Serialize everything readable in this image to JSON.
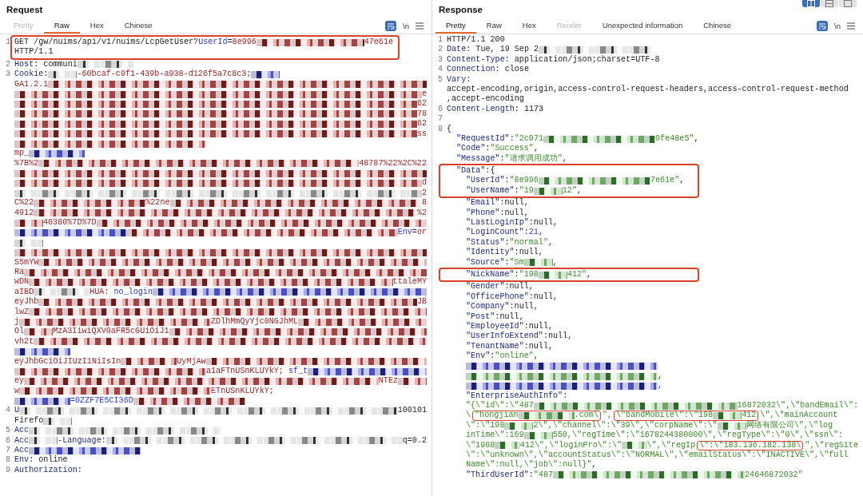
{
  "layout_toggles": [
    {
      "selected": true
    },
    {
      "selected": false
    },
    {
      "selected": false
    }
  ],
  "request": {
    "title": "Request",
    "tabs": [
      {
        "label": "Pretty",
        "selected": false,
        "disabled": true
      },
      {
        "label": "Raw",
        "selected": true,
        "disabled": false
      },
      {
        "label": "Hex",
        "selected": false,
        "disabled": false
      },
      {
        "label": "Chinese",
        "selected": false,
        "disabled": false
      }
    ],
    "toolbar": {
      "wrap_on": true,
      "newline_label": "\\n"
    },
    "lines": [
      {
        "kind": "boxed_rows",
        "rows": [
          {
            "kind": "row",
            "number": "1",
            "segments": [
              {
                "kind": "plain",
                "text": "GET /gw/nuims/api/v1/nuims/LcpGetUser?"
              },
              {
                "kind": "param",
                "text": "UserId"
              },
              {
                "kind": "plain",
                "text": "="
              },
              {
                "kind": "value",
                "text": "8e996"
              },
              {
                "kind": "redacted_red_l"
              },
              {
                "kind": "value",
                "text": "47e61e"
              }
            ]
          },
          {
            "kind": "row",
            "segments": [
              {
                "kind": "plain",
                "text": "HTTP/1.1"
              }
            ]
          }
        ]
      },
      {
        "kind": "row",
        "number": "2",
        "segments": [
          {
            "kind": "header",
            "text": "Host"
          },
          {
            "kind": "plain",
            "text": ": communi"
          },
          {
            "kind": "redacted_grey_m"
          }
        ]
      },
      {
        "kind": "row",
        "number": "3",
        "segments": [
          {
            "kind": "header",
            "text": "Cookie"
          },
          {
            "kind": "plain",
            "text": ":"
          },
          {
            "kind": "redacted_grey_s"
          },
          {
            "kind": "value",
            "text": "-60bcaf-c9f1-439b-a938-d126f5a7c8c3;"
          },
          {
            "kind": "redacted_blue_s"
          }
        ]
      },
      {
        "kind": "row",
        "segments": [
          {
            "kind": "value",
            "text": "GA1.2.1"
          },
          {
            "kind": "redacted_red"
          }
        ]
      },
      {
        "kind": "row",
        "segments": [
          {
            "kind": "redacted_red"
          },
          {
            "kind": "value",
            "text": "e"
          }
        ]
      },
      {
        "kind": "row",
        "segments": [
          {
            "kind": "redacted_red"
          },
          {
            "kind": "value",
            "text": "62"
          }
        ]
      },
      {
        "kind": "row",
        "segments": [
          {
            "kind": "redacted_red"
          },
          {
            "kind": "value",
            "text": "78"
          }
        ]
      },
      {
        "kind": "row",
        "segments": [
          {
            "kind": "redacted_red"
          },
          {
            "kind": "value",
            "text": "62"
          }
        ]
      },
      {
        "kind": "row",
        "segments": [
          {
            "kind": "redacted_red"
          },
          {
            "kind": "value",
            "text": "ss"
          }
        ]
      },
      {
        "kind": "row",
        "segments": [
          {
            "kind": "redacted_red_xl"
          }
        ]
      },
      {
        "kind": "row",
        "segments": [
          {
            "kind": "value",
            "text": "mp_"
          },
          {
            "kind": "redacted_blue_m"
          }
        ]
      },
      {
        "kind": "row",
        "segments": [
          {
            "kind": "value",
            "text": "%7B%2"
          },
          {
            "kind": "redacted_red"
          },
          {
            "kind": "value",
            "text": "48787%22%2C%22"
          }
        ]
      },
      {
        "kind": "row",
        "segments": [
          {
            "kind": "redacted_red"
          }
        ]
      },
      {
        "kind": "row",
        "segments": [
          {
            "kind": "redacted_red"
          },
          {
            "kind": "value",
            "text": "d"
          }
        ]
      },
      {
        "kind": "row",
        "segments": [
          {
            "kind": "redacted_grey"
          },
          {
            "kind": "value",
            "text": "2"
          }
        ]
      },
      {
        "kind": "row",
        "segments": [
          {
            "kind": "value",
            "text": "C%22"
          },
          {
            "kind": "redacted_red_l"
          },
          {
            "kind": "value",
            "text": "%22ne"
          },
          {
            "kind": "redacted_red"
          },
          {
            "kind": "value",
            "text": "8"
          }
        ]
      },
      {
        "kind": "row",
        "segments": [
          {
            "kind": "value",
            "text": "4912"
          },
          {
            "kind": "redacted_red"
          },
          {
            "kind": "value",
            "text": "%2"
          }
        ]
      },
      {
        "kind": "row",
        "segments": [
          {
            "kind": "redacted_red_s"
          },
          {
            "kind": "value",
            "text": "40380%7D%7D"
          },
          {
            "kind": "redacted_red"
          }
        ]
      },
      {
        "kind": "row",
        "segments": [
          {
            "kind": "redacted_blue_l"
          },
          {
            "kind": "redacted_red"
          },
          {
            "kind": "param",
            "text": "Env"
          },
          {
            "kind": "plain",
            "text": "="
          },
          {
            "kind": "value",
            "text": "or"
          }
        ]
      },
      {
        "kind": "row",
        "segments": [
          {
            "kind": "redacted_grey_s"
          }
        ]
      },
      {
        "kind": "row",
        "segments": [
          {
            "kind": "redacted_red"
          }
        ]
      },
      {
        "kind": "row",
        "segments": [
          {
            "kind": "value",
            "text": "S5mYW"
          },
          {
            "kind": "redacted_red"
          }
        ]
      },
      {
        "kind": "row",
        "segments": [
          {
            "kind": "value",
            "text": "Ra"
          },
          {
            "kind": "redacted_red"
          }
        ]
      },
      {
        "kind": "row",
        "segments": [
          {
            "kind": "value",
            "text": "wDN"
          },
          {
            "kind": "redacted_red"
          },
          {
            "kind": "value",
            "text": "ttaleMY"
          }
        ]
      },
      {
        "kind": "row",
        "segments": [
          {
            "kind": "value",
            "text": "aIBD"
          },
          {
            "kind": "redacted_grey_m"
          },
          {
            "kind": "value",
            "text": "HUA: "
          },
          {
            "kind": "param",
            "text": "no_login"
          },
          {
            "kind": "redacted_blue"
          }
        ]
      },
      {
        "kind": "row",
        "segments": [
          {
            "kind": "value",
            "text": "eyJhb"
          },
          {
            "kind": "redacted_red"
          },
          {
            "kind": "value",
            "text": "JB"
          }
        ]
      },
      {
        "kind": "row",
        "segments": [
          {
            "kind": "value",
            "text": "lwZ"
          },
          {
            "kind": "redacted_red"
          }
        ]
      },
      {
        "kind": "row",
        "segments": [
          {
            "kind": "value",
            "text": "j"
          },
          {
            "kind": "redacted_red_xl"
          },
          {
            "kind": "value",
            "text": "ZDlhMmQyYjc0NGJhML"
          },
          {
            "kind": "redacted_red"
          }
        ]
      },
      {
        "kind": "row",
        "segments": [
          {
            "kind": "value",
            "text": "Ol"
          },
          {
            "kind": "redacted_red_s"
          },
          {
            "kind": "value",
            "text": "MzA3IiwiQXV0aFR5cGUiOiJ1"
          },
          {
            "kind": "redacted_red"
          }
        ]
      },
      {
        "kind": "row",
        "segments": [
          {
            "kind": "value",
            "text": "vh2t"
          },
          {
            "kind": "redacted_red"
          }
        ]
      },
      {
        "kind": "row",
        "segments": [
          {
            "kind": "redacted_blue_m"
          }
        ]
      },
      {
        "kind": "row",
        "segments": [
          {
            "kind": "value",
            "text": "eyJhbGciOiJIUzI1NiIsIn"
          },
          {
            "kind": "redacted_red_m"
          },
          {
            "kind": "value",
            "text": "UyMjAw"
          },
          {
            "kind": "redacted_red"
          }
        ]
      },
      {
        "kind": "row",
        "segments": [
          {
            "kind": "redacted_red_xl"
          },
          {
            "kind": "value",
            "text": "a1aFTnUSnKLUYkY; "
          },
          {
            "kind": "param",
            "text": "sf_t"
          },
          {
            "kind": "redacted_blue"
          }
        ]
      },
      {
        "kind": "row",
        "segments": [
          {
            "kind": "value",
            "text": "ey"
          },
          {
            "kind": "redacted_red"
          },
          {
            "kind": "value",
            "text": "NTEz"
          },
          {
            "kind": "redacted_red_s"
          }
        ]
      },
      {
        "kind": "row",
        "segments": [
          {
            "kind": "value",
            "text": "w"
          },
          {
            "kind": "redacted_red_xl"
          },
          {
            "kind": "value",
            "text": "ETnUSnKLUYkY;"
          }
        ]
      },
      {
        "kind": "row",
        "segments": [
          {
            "kind": "redacted_blue_m"
          },
          {
            "kind": "param",
            "text": "=0ZZF7E5CI36D"
          },
          {
            "kind": "redacted_red_l"
          }
        ]
      },
      {
        "kind": "row",
        "number": "4",
        "segments": [
          {
            "kind": "header",
            "text": "U"
          },
          {
            "kind": "redacted_grey"
          },
          {
            "kind": "plain",
            "text": "100101"
          }
        ]
      },
      {
        "kind": "row",
        "segments": [
          {
            "kind": "plain",
            "text": "Firefo"
          },
          {
            "kind": "redacted_grey_s"
          }
        ]
      },
      {
        "kind": "row",
        "number": "5",
        "segments": [
          {
            "kind": "header",
            "text": "Acc"
          },
          {
            "kind": "redacted_grey_xl"
          }
        ]
      },
      {
        "kind": "row",
        "number": "6",
        "segments": [
          {
            "kind": "header",
            "text": "Acc"
          },
          {
            "kind": "redacted_grey_s"
          },
          {
            "kind": "header",
            "text": "-Language"
          },
          {
            "kind": "plain",
            "text": ":"
          },
          {
            "kind": "redacted_grey"
          },
          {
            "kind": "plain",
            "text": "q=0.2"
          }
        ]
      },
      {
        "kind": "row",
        "number": "7",
        "segments": [
          {
            "kind": "header",
            "text": "Acc"
          },
          {
            "kind": "redacted_blue_l"
          }
        ]
      },
      {
        "kind": "row",
        "number": "8",
        "segments": [
          {
            "kind": "header",
            "text": "Env"
          },
          {
            "kind": "plain",
            "text": ": online"
          }
        ]
      },
      {
        "kind": "row",
        "number": "9",
        "segments": [
          {
            "kind": "header",
            "text": "Authorization"
          },
          {
            "kind": "plain",
            "text": ":"
          }
        ]
      }
    ]
  },
  "response": {
    "title": "Response",
    "tabs": [
      {
        "label": "Pretty",
        "selected": true,
        "disabled": false
      },
      {
        "label": "Raw",
        "selected": false,
        "disabled": false
      },
      {
        "label": "Hex",
        "selected": false,
        "disabled": false
      },
      {
        "label": "Render",
        "selected": false,
        "disabled": true
      },
      {
        "label": "Unexpected information",
        "selected": false,
        "disabled": false
      },
      {
        "label": "Chinese",
        "selected": false,
        "disabled": false
      }
    ],
    "toolbar": {
      "wrap_on": true,
      "newline_label": "\\n"
    },
    "lines": [
      {
        "kind": "row",
        "number": "1",
        "segments": [
          {
            "kind": "plain",
            "text": "HTTP/1.1 200"
          }
        ]
      },
      {
        "kind": "row",
        "number": "2",
        "segments": [
          {
            "kind": "header",
            "text": "Date"
          },
          {
            "kind": "plain",
            "text": ": Tue, 19 Sep 2"
          },
          {
            "kind": "redacted_grey_l"
          }
        ]
      },
      {
        "kind": "row",
        "number": "3",
        "segments": [
          {
            "kind": "header",
            "text": "Content-Type"
          },
          {
            "kind": "plain",
            "text": ": application/json;charset=UTF-8"
          }
        ]
      },
      {
        "kind": "row",
        "number": "4",
        "segments": [
          {
            "kind": "header",
            "text": "Connection"
          },
          {
            "kind": "plain",
            "text": ": close"
          }
        ]
      },
      {
        "kind": "row",
        "number": "5",
        "segments": [
          {
            "kind": "header",
            "text": "Vary"
          },
          {
            "kind": "plain",
            "text": ":"
          }
        ]
      },
      {
        "kind": "row",
        "segments": [
          {
            "kind": "plain",
            "text": "accept-encoding,origin,access-control-request-headers,access-control-request-method"
          }
        ]
      },
      {
        "kind": "row",
        "segments": [
          {
            "kind": "plain",
            "text": ",accept-encoding"
          }
        ]
      },
      {
        "kind": "row",
        "number": "6",
        "segments": [
          {
            "kind": "header",
            "text": "Content-Length"
          },
          {
            "kind": "plain",
            "text": ": 1173"
          }
        ]
      },
      {
        "kind": "row",
        "number": "7"
      },
      {
        "kind": "row",
        "number": "8",
        "segments": [
          {
            "kind": "plain",
            "text": "{"
          }
        ]
      },
      {
        "kind": "member",
        "segments": [
          {
            "kind": "key",
            "text": "\"RequestId\""
          },
          {
            "kind": "plain",
            "text": ":"
          },
          {
            "kind": "str",
            "text": "\"2c071"
          },
          {
            "kind": "redacted_green_l"
          },
          {
            "kind": "str",
            "text": "0fe48e5\""
          },
          {
            "kind": "plain",
            "text": ","
          }
        ]
      },
      {
        "kind": "member",
        "segments": [
          {
            "kind": "key",
            "text": "\"Code\""
          },
          {
            "kind": "plain",
            "text": ":"
          },
          {
            "kind": "str",
            "text": "\"Success\""
          },
          {
            "kind": "plain",
            "text": ","
          }
        ]
      },
      {
        "kind": "member",
        "segments": [
          {
            "kind": "key",
            "text": "\"Message\""
          },
          {
            "kind": "plain",
            "text": ":"
          },
          {
            "kind": "str",
            "text": "\"请求调用成功\""
          },
          {
            "kind": "plain",
            "text": ","
          }
        ]
      },
      {
        "kind": "boxed_rows",
        "rows": [
          {
            "kind": "member",
            "segments": [
              {
                "kind": "key",
                "text": "\"Data\""
              },
              {
                "kind": "plain",
                "text": ":{"
              }
            ]
          },
          {
            "kind": "nested",
            "segments": [
              {
                "kind": "key",
                "text": "\"UserId\""
              },
              {
                "kind": "plain",
                "text": ":"
              },
              {
                "kind": "str",
                "text": "\"8e996"
              },
              {
                "kind": "redacted_green_l"
              },
              {
                "kind": "str",
                "text": "7e61e\""
              },
              {
                "kind": "plain",
                "text": ","
              }
            ]
          },
          {
            "kind": "nested",
            "segments": [
              {
                "kind": "key",
                "text": "\"UserName\""
              },
              {
                "kind": "plain",
                "text": ":"
              },
              {
                "kind": "str",
                "text": "\"19"
              },
              {
                "kind": "redacted_green_s"
              },
              {
                "kind": "str",
                "text": "12\""
              },
              {
                "kind": "plain",
                "text": ","
              }
            ]
          }
        ]
      },
      {
        "kind": "nested",
        "segments": [
          {
            "kind": "key",
            "text": "\"Email\""
          },
          {
            "kind": "plain",
            "text": ":null,"
          }
        ]
      },
      {
        "kind": "nested",
        "segments": [
          {
            "kind": "key",
            "text": "\"Phone\""
          },
          {
            "kind": "plain",
            "text": ":null,"
          }
        ]
      },
      {
        "kind": "nested",
        "segments": [
          {
            "kind": "key",
            "text": "\"LastLoginIp\""
          },
          {
            "kind": "plain",
            "text": ":null,"
          }
        ]
      },
      {
        "kind": "nested",
        "segments": [
          {
            "kind": "key",
            "text": "\"LoginCount\""
          },
          {
            "kind": "plain",
            "text": ":"
          },
          {
            "kind": "num",
            "text": "21"
          },
          {
            "kind": "plain",
            "text": ","
          }
        ]
      },
      {
        "kind": "nested",
        "segments": [
          {
            "kind": "key",
            "text": "\"Status\""
          },
          {
            "kind": "plain",
            "text": ":"
          },
          {
            "kind": "str",
            "text": "\"normal\""
          },
          {
            "kind": "plain",
            "text": ","
          }
        ]
      },
      {
        "kind": "nested",
        "segments": [
          {
            "kind": "key",
            "text": "\"Identity\""
          },
          {
            "kind": "plain",
            "text": ":null,"
          }
        ]
      },
      {
        "kind": "nested",
        "segments": [
          {
            "kind": "key",
            "text": "\"Source\""
          },
          {
            "kind": "plain",
            "text": ":"
          },
          {
            "kind": "str",
            "text": "\"Sm"
          },
          {
            "kind": "redacted_green_s"
          },
          {
            "kind": "plain",
            "text": ","
          }
        ]
      },
      {
        "kind": "boxed_rows",
        "rows": [
          {
            "kind": "nested",
            "segments": [
              {
                "kind": "key",
                "text": "\"NickName\""
              },
              {
                "kind": "plain",
                "text": ":"
              },
              {
                "kind": "str",
                "text": "\"198"
              },
              {
                "kind": "redacted_green_s"
              },
              {
                "kind": "str",
                "text": "412\""
              },
              {
                "kind": "plain",
                "text": ","
              }
            ]
          }
        ]
      },
      {
        "kind": "nested",
        "segments": [
          {
            "kind": "key",
            "text": "\"Gender\""
          },
          {
            "kind": "plain",
            "text": ":null,"
          }
        ]
      },
      {
        "kind": "nested",
        "segments": [
          {
            "kind": "key",
            "text": "\"OfficePhone\""
          },
          {
            "kind": "plain",
            "text": ":null,"
          }
        ]
      },
      {
        "kind": "nested",
        "segments": [
          {
            "kind": "key",
            "text": "\"Company\""
          },
          {
            "kind": "plain",
            "text": ":null,"
          }
        ]
      },
      {
        "kind": "nested",
        "segments": [
          {
            "kind": "key",
            "text": "\"Post\""
          },
          {
            "kind": "plain",
            "text": ":null,"
          }
        ]
      },
      {
        "kind": "nested",
        "segments": [
          {
            "kind": "key",
            "text": "\"EmployeeId\""
          },
          {
            "kind": "plain",
            "text": ":null,"
          }
        ]
      },
      {
        "kind": "nested",
        "segments": [
          {
            "kind": "key",
            "text": "\"UserInfoExtend\""
          },
          {
            "kind": "plain",
            "text": ":null,"
          }
        ]
      },
      {
        "kind": "nested",
        "segments": [
          {
            "kind": "key",
            "text": "\"TenantName\""
          },
          {
            "kind": "plain",
            "text": ":null,"
          }
        ]
      },
      {
        "kind": "nested",
        "segments": [
          {
            "kind": "key",
            "text": "\"Env\""
          },
          {
            "kind": "plain",
            "text": ":"
          },
          {
            "kind": "str",
            "text": "\"online\""
          },
          {
            "kind": "plain",
            "text": ","
          }
        ]
      },
      {
        "kind": "nested",
        "segments": [
          {
            "kind": "redacted_blue_xl"
          }
        ]
      },
      {
        "kind": "nested",
        "segments": [
          {
            "kind": "redacted_green_xl"
          },
          {
            "kind": "plain",
            "text": ","
          }
        ]
      },
      {
        "kind": "nested",
        "segments": [
          {
            "kind": "redacted_blue_xl"
          },
          {
            "kind": "plain",
            "text": ","
          }
        ]
      },
      {
        "kind": "nested",
        "segments": [
          {
            "kind": "key",
            "text": "\"EnterpriseAuthInfo\""
          },
          {
            "kind": "plain",
            "text": ":"
          }
        ]
      },
      {
        "kind": "nested",
        "segments": [
          {
            "kind": "str",
            "text": "\"{\\\"id\\\":\\\"487"
          },
          {
            "kind": "redacted_green"
          },
          {
            "kind": "str",
            "text": "16872032\\\",\\\"bandEmail\\\":"
          }
        ]
      },
      {
        "kind": "nested",
        "segments": [
          {
            "kind": "str",
            "text": "\\"
          },
          {
            "kind": "boxed",
            "parts": [
              {
                "kind": "str",
                "text": "\"hongjian"
              },
              {
                "kind": "redacted_green_m"
              },
              {
                "kind": "str",
                "text": ".com\\"
              }
            ]
          },
          {
            "kind": "str",
            "text": "\","
          },
          {
            "kind": "boxed",
            "parts": [
              {
                "kind": "str",
                "text": "\\\"bandMobile\\\":\\\"198"
              },
              {
                "kind": "redacted_green_s"
              },
              {
                "kind": "str",
                "text": "412"
              }
            ]
          },
          {
            "kind": "str",
            "text": "\\\",\\\"mainAccount"
          }
        ]
      },
      {
        "kind": "nested",
        "segments": [
          {
            "kind": "str",
            "text": "\\\":\\\"198"
          },
          {
            "kind": "redacted_green_s"
          },
          {
            "kind": "str",
            "text": "2\\\",\\\"channel\\\":\\\"39\\\",\\\"corpName\\\":\\\""
          },
          {
            "kind": "redacted_green_s"
          },
          {
            "kind": "str",
            "text": "网络有限公司\\\",\\\"log"
          }
        ]
      },
      {
        "kind": "nested",
        "segments": [
          {
            "kind": "str",
            "text": "inTime\\\":169"
          },
          {
            "kind": "redacted_green_s"
          },
          {
            "kind": "str",
            "text": "550,\\\"regTime\\\":\\\"1678244380000\\\",\\\"regType\\\":\\\"0\\\",\\\"ssn\\\":"
          }
        ]
      },
      {
        "kind": "nested",
        "segments": [
          {
            "kind": "str",
            "text": "\\\"1988"
          },
          {
            "kind": "redacted_green_s"
          },
          {
            "kind": "str",
            "text": "412\\\",\\\"loginPro\\\":\\\""
          },
          {
            "kind": "redacted_green_s"
          },
          {
            "kind": "str",
            "text": "\\\",\\\"regIp"
          },
          {
            "kind": "boxed",
            "parts": [
              {
                "kind": "str",
                "text": "\\\":\\\"183.136.182.138\\"
              }
            ]
          },
          {
            "kind": "str",
            "text": "\",\\\"regSite"
          }
        ]
      },
      {
        "kind": "nested",
        "segments": [
          {
            "kind": "str",
            "text": "\\\":\\\"unknown\\\",\\\"accountStatus\\\":\\\"NORMAL\\\",\\\"emailStatus\\\":\\\"INACTIVE\\\",\\\"full"
          }
        ]
      },
      {
        "kind": "nested",
        "segments": [
          {
            "kind": "str",
            "text": "Name\\\":null,\\\"job\\\":null}\""
          },
          {
            "kind": "plain",
            "text": ","
          }
        ]
      },
      {
        "kind": "nested",
        "segments": [
          {
            "kind": "key",
            "text": "\"ThirdUserId\""
          },
          {
            "kind": "plain",
            "text": ":"
          },
          {
            "kind": "str",
            "text": "\"487"
          },
          {
            "kind": "redacted_green_xl"
          },
          {
            "kind": "str",
            "text": "24646872032\""
          }
        ]
      }
    ]
  }
}
